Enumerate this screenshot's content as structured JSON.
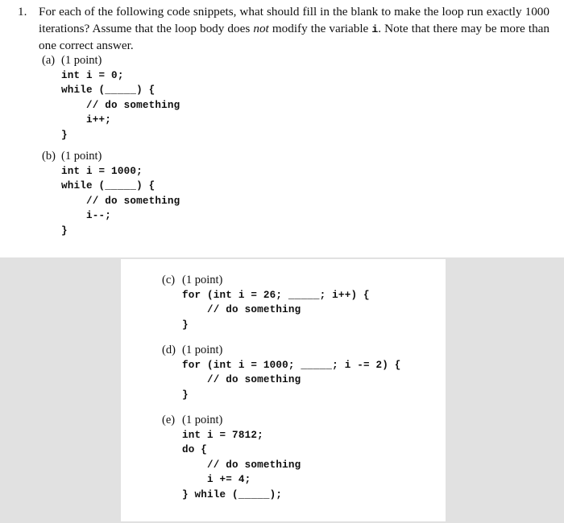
{
  "document": {
    "question": {
      "number": "1.",
      "text_before_italic": "For each of the following code snippets, what should fill in the blank to make the loop run exactly 1000 iterations? Assume that the loop body does ",
      "italic_word": "not",
      "text_after_italic": " modify the variable ",
      "mono_var": "i",
      "text_end": ". Note that there may be more than one correct answer."
    },
    "blank_placeholder": "_____",
    "parts": [
      {
        "label": "(a)",
        "points": "(1 point)",
        "code": "int i = 0;\nwhile (_____) {\n    // do something\n    i++;\n}"
      },
      {
        "label": "(b)",
        "points": "(1 point)",
        "code": "int i = 1000;\nwhile (_____) {\n    // do something\n    i--;\n}"
      },
      {
        "label": "(c)",
        "points": "(1 point)",
        "code": "for (int i = 26; _____; i++) {\n    // do something\n}"
      },
      {
        "label": "(d)",
        "points": "(1 point)",
        "code": "for (int i = 1000; _____; i -= 2) {\n    // do something\n}"
      },
      {
        "label": "(e)",
        "points": "(1 point)",
        "code": "int i = 7812;\ndo {\n    // do something\n    i += 4;\n} while (_____);"
      }
    ]
  },
  "colors": {
    "page_background": "#ffffff",
    "band_background": "#e1e1e1",
    "text": "#111111"
  }
}
